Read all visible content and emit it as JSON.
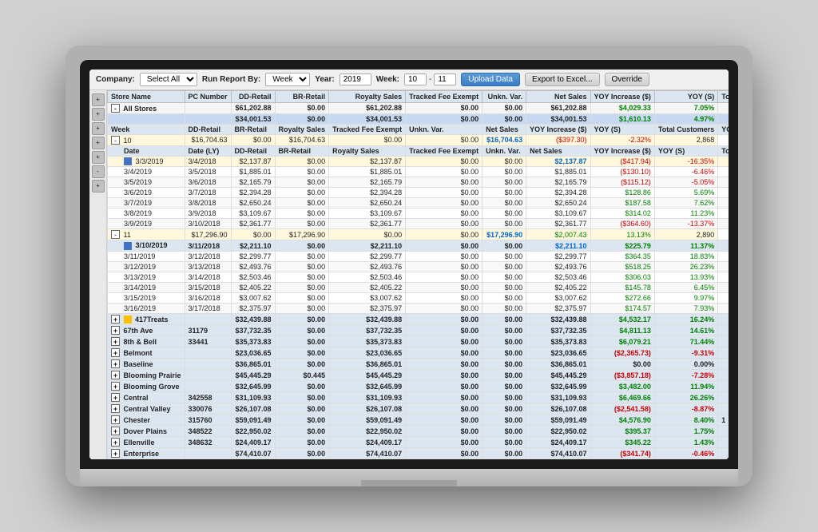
{
  "toolbar": {
    "company_label": "Company:",
    "company_value": "Select All",
    "run_report_label": "Run Report By:",
    "run_report_value": "Week",
    "year_label": "Year:",
    "year_value": "2019",
    "week_label": "Week:",
    "week_from": "10",
    "week_to": "11",
    "btn_upload": "Upload Data",
    "btn_export": "Export to Excel...",
    "btn_override": "Override"
  },
  "columns": {
    "store_name": "Store Name",
    "pc_number": "PC Number",
    "dd_retail": "DD-Retail",
    "br_retail": "BR-Retail",
    "royalty_sales": "Royalty Sales",
    "tracked_fee_exempt": "Tracked Fee Exempt",
    "unkn_var": "Unkn. Var.",
    "net_sales": "Net Sales",
    "yoy_increase_s": "YOY Increase ($)",
    "yoy_s": "YOY (S)",
    "total_customers": "Total Custom..."
  },
  "top_row": {
    "store": "All Stores",
    "pc": "",
    "dd": "$61,202.88",
    "br": "$0.00",
    "royalty": "$61,202.88",
    "tracked": "$0.00",
    "unkn": "$0.00",
    "net": "$61,202.88",
    "yoy_s": "$4,029.33",
    "yoy_pct": "7.05%",
    "customers": ""
  },
  "summary_row": {
    "dd": "$34,001.53",
    "br": "$0.00",
    "royalty": "$34,001.53",
    "tracked": "$0.00",
    "unkn": "$0.00",
    "net": "$34,001.53",
    "yoy_s": "$1,610.13",
    "yoy_pct": "4.97%"
  },
  "week10_header": {
    "week": "Week",
    "dd": "DD-Retail",
    "br": "BR-Retail",
    "royalty": "Royalty Sales",
    "tracked": "Tracked Fee Exempt",
    "unkn": "Unkn. Var.",
    "net": "Net Sales",
    "yoy_s": "YOY Increase ($)",
    "yoy_pct": "YOY (S)",
    "customers": "Total Customers",
    "yoy_inc": "YOY Incre..."
  },
  "week10_row": {
    "week": "10",
    "dd": "$16,704.63",
    "br": "$0.00",
    "royalty": "$16,704.63",
    "tracked": "$0.00",
    "unkn": "$0.00",
    "net": "$16,704.63",
    "yoy_s": "($397.30)",
    "yoy_pct": "-2.32%",
    "customers": "2,868"
  },
  "detail_columns": {
    "date": "Date",
    "date_ly": "Date (LY)",
    "dd": "DD-Retail",
    "br": "BR-Retail",
    "royalty": "Royalty Sales",
    "tracked": "Tracked Fee Exempt",
    "unkn": "Unkn. Var.",
    "net": "Net Sales",
    "yoy_s": "YOY Increase ($)",
    "yoy_pct": "YOY (S)",
    "customers": "Total Custo..."
  },
  "week10_details": [
    {
      "date": "3/3/2019",
      "date_ly": "3/4/2018",
      "dd": "$2,137.87",
      "br": "$0.00",
      "royalty": "$2,137.87",
      "tracked": "$0.00",
      "unkn": "$0.00",
      "net": "$2,137.87",
      "yoy_s": "($417.94)",
      "yoy_pct": "-16.35%",
      "neg": true,
      "highlight": true
    },
    {
      "date": "3/4/2019",
      "date_ly": "3/5/2018",
      "dd": "$1,885.01",
      "br": "$0.00",
      "royalty": "$1,885.01",
      "tracked": "$0.00",
      "unkn": "$0.00",
      "net": "$1,885.01",
      "yoy_s": "($130.10)",
      "yoy_pct": "-6.46%",
      "neg": true
    },
    {
      "date": "3/5/2019",
      "date_ly": "3/6/2018",
      "dd": "$2,165.79",
      "br": "$0.00",
      "royalty": "$2,165.79",
      "tracked": "$0.00",
      "unkn": "$0.00",
      "net": "$2,165.79",
      "yoy_s": "($115.12)",
      "yoy_pct": "-5.05%",
      "neg": true
    },
    {
      "date": "3/6/2019",
      "date_ly": "3/7/2018",
      "dd": "$2,394.28",
      "br": "$0.00",
      "royalty": "$2,394.28",
      "tracked": "$0.00",
      "unkn": "$0.00",
      "net": "$2,394.28",
      "yoy_s": "$128.86",
      "yoy_pct": "5.69%",
      "neg": false
    },
    {
      "date": "3/7/2019",
      "date_ly": "3/8/2018",
      "dd": "$2,650.24",
      "br": "$0.00",
      "royalty": "$2,650.24",
      "tracked": "$0.00",
      "unkn": "$0.00",
      "net": "$2,650.24",
      "yoy_s": "$187.58",
      "yoy_pct": "7.62%",
      "neg": false
    },
    {
      "date": "3/8/2019",
      "date_ly": "3/9/2018",
      "dd": "$3,109.67",
      "br": "$0.00",
      "royalty": "$3,109.67",
      "tracked": "$0.00",
      "unkn": "$0.00",
      "net": "$3,109.67",
      "yoy_s": "$314.02",
      "yoy_pct": "11.23%",
      "neg": false
    },
    {
      "date": "3/9/2019",
      "date_ly": "3/10/2018",
      "dd": "$2,361.77",
      "br": "$0.00",
      "royalty": "$2,361.77",
      "tracked": "$0.00",
      "unkn": "$0.00",
      "net": "$2,361.77",
      "yoy_s": "($364.60)",
      "yoy_pct": "-13.37%",
      "neg": true
    }
  ],
  "week11_row": {
    "week": "11",
    "dd": "$17,296.90",
    "br": "$0.00",
    "royalty": "$17,296.90",
    "tracked": "$0.00",
    "unkn": "$0.00",
    "net": "$17,296.90",
    "yoy_s": "$2,007.43",
    "yoy_pct": "13.13%",
    "customers": "2,890"
  },
  "week11_header_row": {
    "date": "3/10/2019",
    "date_ly": "3/11/2018",
    "dd": "$2,211.10",
    "br": "$0.00",
    "royalty": "$2,211.10",
    "tracked": "$0.00",
    "unkn": "$0.00",
    "net": "$2,211.10",
    "yoy_s": "$225.79",
    "yoy_pct": "11.37%"
  },
  "week11_details": [
    {
      "date": "3/11/2019",
      "date_ly": "3/12/2018",
      "dd": "$2,299.77",
      "br": "$0.00",
      "royalty": "$2,299.77",
      "tracked": "$0.00",
      "unkn": "$0.00",
      "net": "$2,299.77",
      "yoy_s": "$364.35",
      "yoy_pct": "18.83%",
      "neg": false
    },
    {
      "date": "3/12/2019",
      "date_ly": "3/13/2018",
      "dd": "$2,493.76",
      "br": "$0.00",
      "royalty": "$2,493.76",
      "tracked": "$0.00",
      "unkn": "$0.00",
      "net": "$2,493.76",
      "yoy_s": "$518.25",
      "yoy_pct": "26.23%",
      "neg": false
    },
    {
      "date": "3/13/2019",
      "date_ly": "3/14/2018",
      "dd": "$2,503.46",
      "br": "$0.00",
      "royalty": "$2,503.46",
      "tracked": "$0.00",
      "unkn": "$0.00",
      "net": "$2,503.46",
      "yoy_s": "$306.03",
      "yoy_pct": "13.93%",
      "neg": false
    },
    {
      "date": "3/14/2019",
      "date_ly": "3/15/2018",
      "dd": "$2,405.22",
      "br": "$0.00",
      "royalty": "$2,405.22",
      "tracked": "$0.00",
      "unkn": "$0.00",
      "net": "$2,405.22",
      "yoy_s": "$145.78",
      "yoy_pct": "6.45%",
      "neg": false
    },
    {
      "date": "3/15/2019",
      "date_ly": "3/16/2018",
      "dd": "$3,007.62",
      "br": "$0.00",
      "royalty": "$3,007.62",
      "tracked": "$0.00",
      "unkn": "$0.00",
      "net": "$3,007.62",
      "yoy_s": "$272.66",
      "yoy_pct": "9.97%",
      "neg": false
    },
    {
      "date": "3/16/2019",
      "date_ly": "3/17/2018",
      "dd": "$2,375.97",
      "br": "$0.00",
      "royalty": "$2,375.97",
      "tracked": "$0.00",
      "unkn": "$0.00",
      "net": "$2,375.97",
      "yoy_s": "$174.57",
      "yoy_pct": "7.93%",
      "neg": false
    }
  ],
  "stores": [
    {
      "name": "417Treats",
      "pc": "",
      "dd": "$32,439.88",
      "br": "$0.00",
      "royalty": "$32,439.88",
      "tracked": "$0.00",
      "unkn": "$0.00",
      "net": "$32,439.88",
      "yoy_s": "$4,532.17",
      "yoy_pct": "16.24%",
      "neg": false
    },
    {
      "name": "67th Ave",
      "pc": "31179",
      "dd": "$37,732.35",
      "br": "$0.00",
      "royalty": "$37,732.35",
      "tracked": "$0.00",
      "unkn": "$0.00",
      "net": "$37,732.35",
      "yoy_s": "$4,811.13",
      "yoy_pct": "14.61%",
      "neg": false
    },
    {
      "name": "8th & Bell",
      "pc": "33441",
      "dd": "$35,373.83",
      "br": "$0.00",
      "royalty": "$35,373.83",
      "tracked": "$0.00",
      "unkn": "$0.00",
      "net": "$35,373.83",
      "yoy_s": "$6,079.21",
      "yoy_pct": "71.44%",
      "neg": false
    },
    {
      "name": "Belmont",
      "pc": "",
      "dd": "$23,036.65",
      "br": "$0.00",
      "royalty": "$23,036.65",
      "tracked": "$0.00",
      "unkn": "$0.00",
      "net": "$23,036.65",
      "yoy_s": "($2,365.73)",
      "yoy_pct": "-9.31%",
      "neg": true
    },
    {
      "name": "Baseline",
      "pc": "",
      "dd": "$36,865.01",
      "br": "$0.00",
      "royalty": "$36,865.01",
      "tracked": "$0.00",
      "unkn": "$0.00",
      "net": "$36,865.01",
      "yoy_s": "$0.00",
      "yoy_pct": "0.00%",
      "neg": false
    },
    {
      "name": "Blooming Prairie",
      "pc": "",
      "dd": "$45,445.29",
      "br": "$0.445",
      "royalty": "$45,445.29",
      "tracked": "$0.00",
      "unkn": "$0.00",
      "net": "$45,445.29",
      "yoy_s": "($3,857.18)",
      "yoy_pct": "-7.28%",
      "neg": true
    },
    {
      "name": "Blooming Grove",
      "pc": "",
      "dd": "$32,645.99",
      "br": "$0.00",
      "royalty": "$32,645.99",
      "tracked": "$0.00",
      "unkn": "$0.00",
      "net": "$32,645.99",
      "yoy_s": "$3,482.00",
      "yoy_pct": "11.94%",
      "neg": false
    },
    {
      "name": "Central",
      "pc": "342558",
      "dd": "$31,109.93",
      "br": "$0.00",
      "royalty": "$31,109.93",
      "tracked": "$0.00",
      "unkn": "$0.00",
      "net": "$31,109.93",
      "yoy_s": "$6,469.66",
      "yoy_pct": "26.26%",
      "neg": false
    },
    {
      "name": "Central Valley",
      "pc": "330076",
      "dd": "$26,107.08",
      "br": "$0.00",
      "royalty": "$26,107.08",
      "tracked": "$0.00",
      "unkn": "$0.00",
      "net": "$26,107.08",
      "yoy_s": "($2,541.58)",
      "yoy_pct": "-8.87%",
      "neg": true
    },
    {
      "name": "Chester",
      "pc": "315760",
      "dd": "$59,091.49",
      "br": "$0.00",
      "royalty": "$59,091.49",
      "tracked": "$0.00",
      "unkn": "$0.00",
      "net": "$59,091.49",
      "yoy_s": "$4,576.90",
      "yoy_pct": "8.40%",
      "neg": false
    },
    {
      "name": "Dover Plains",
      "pc": "348522",
      "dd": "$22,950.02",
      "br": "$0.00",
      "royalty": "$22,950.02",
      "tracked": "$0.00",
      "unkn": "$0.00",
      "net": "$22,950.02",
      "yoy_s": "$395.37",
      "yoy_pct": "1.75%",
      "neg": false
    },
    {
      "name": "Ellenville",
      "pc": "348632",
      "dd": "$24,409.17",
      "br": "$0.00",
      "royalty": "$24,409.17",
      "tracked": "$0.00",
      "unkn": "$0.00",
      "net": "$24,409.17",
      "yoy_s": "$345.22",
      "yoy_pct": "1.43%",
      "neg": false
    },
    {
      "name": "Enterprise",
      "pc": "",
      "dd": "$74,410.07",
      "br": "$0.00",
      "royalty": "$74,410.07",
      "tracked": "$0.00",
      "unkn": "$0.00",
      "net": "$74,410.07",
      "yoy_s": "($341.74)",
      "yoy_pct": "-0.46%",
      "neg": true
    }
  ]
}
